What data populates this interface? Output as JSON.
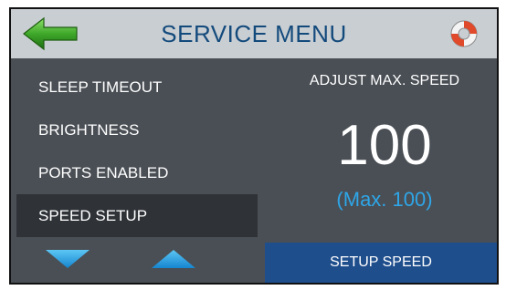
{
  "header": {
    "title": "SERVICE MENU",
    "back_icon": "back-arrow-icon",
    "help_icon": "lifebuoy-icon"
  },
  "menu": {
    "items": [
      {
        "label": "SLEEP TIMEOUT",
        "selected": false
      },
      {
        "label": "BRIGHTNESS",
        "selected": false
      },
      {
        "label": "PORTS ENABLED",
        "selected": false
      },
      {
        "label": "SPEED SETUP",
        "selected": true
      }
    ],
    "scroll_down_icon": "triangle-down-icon",
    "scroll_up_icon": "triangle-up-icon"
  },
  "panel": {
    "label": "ADJUST MAX. SPEED",
    "value": "100",
    "max_text": "(Max. 100)",
    "button_label": "SETUP SPEED"
  },
  "colors": {
    "header_bg": "#c9ced2",
    "title_text": "#134a7c",
    "body_bg": "#4a4f55",
    "selected_item_bg": "#2f3338",
    "accent_blue": "#2ea6e8",
    "button_bg": "#1f4e8c",
    "back_arrow_green": "#3fa82a"
  }
}
